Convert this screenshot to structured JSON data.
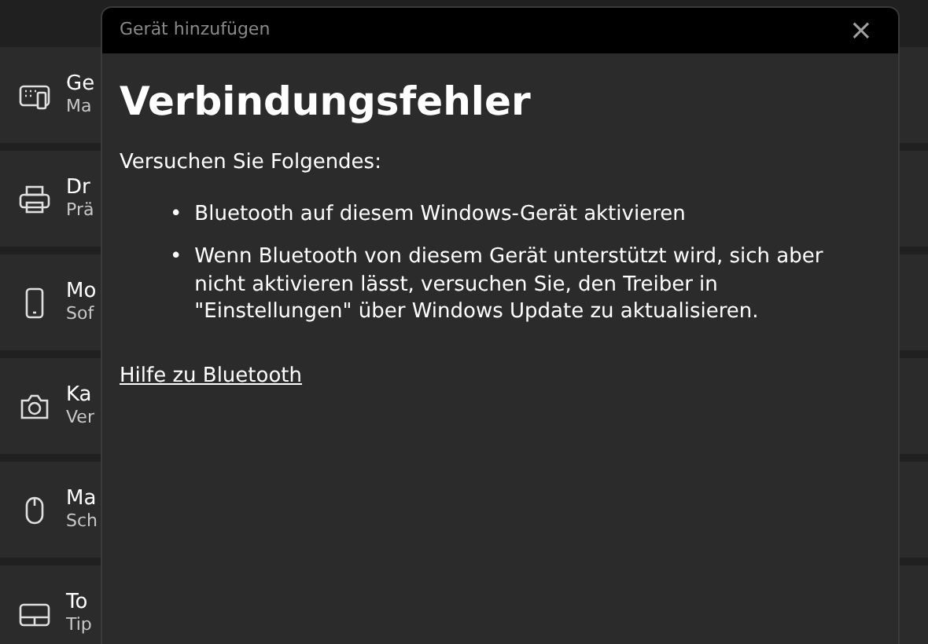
{
  "settings_rows": [
    {
      "kind": "keyboard",
      "title": "Ge",
      "subtitle": "Ma"
    },
    {
      "kind": "printer",
      "title": "Dr",
      "subtitle": "Prä"
    },
    {
      "kind": "phone",
      "title": "Mo",
      "subtitle": "Sof"
    },
    {
      "kind": "camera",
      "title": "Ka",
      "subtitle": "Ver"
    },
    {
      "kind": "mouse",
      "title": "Ma",
      "subtitle": "Sch"
    },
    {
      "kind": "touchpad",
      "title": "To",
      "subtitle": "Tip"
    }
  ],
  "dialog": {
    "title": "Gerät hinzufügen",
    "close": "×",
    "heading": "Verbindungsfehler",
    "intro": "Versuchen Sie Folgendes:",
    "steps": [
      {
        "bullet": "•",
        "text": "Bluetooth auf diesem Windows-Gerät aktivieren"
      },
      {
        "bullet": "•",
        "text": "Wenn Bluetooth von diesem Gerät unterstützt wird, sich aber nicht aktivieren lässt, versuchen Sie, den Treiber in \"Einstellungen\" über Windows Update zu aktualisieren."
      }
    ],
    "link": "Hilfe zu Bluetooth"
  }
}
